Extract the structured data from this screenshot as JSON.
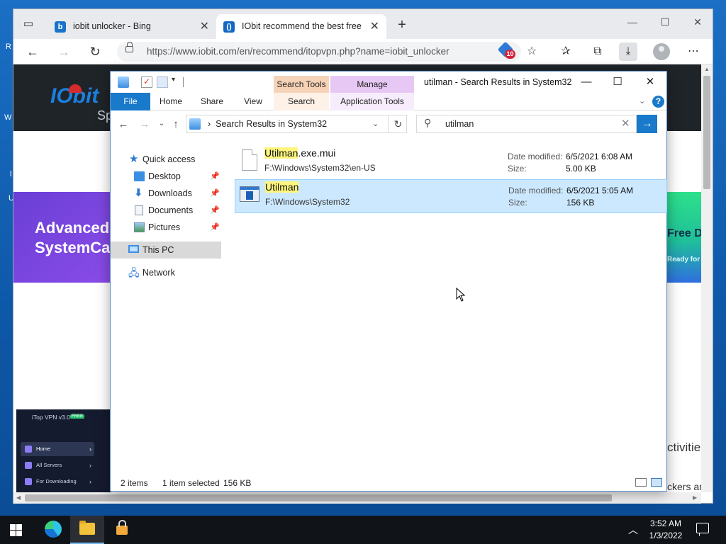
{
  "browser": {
    "tabs": [
      {
        "title": "iobit unlocker - Bing",
        "favicon": "bing-icon",
        "color": "#1a73c9"
      },
      {
        "title": "IObit recommend the best free, IObit",
        "favicon": "iobit-icon",
        "color": "#1467c2"
      }
    ],
    "url": "https://www.iobit.com/en/recommend/itopvpn.php?name=iobit_unlocker",
    "extension_badge": "10"
  },
  "webpage": {
    "banner_left_line1": "Advanced",
    "banner_left_line2": "SystemCa",
    "banner_right_line1": "Free Do",
    "banner_right_line2": "Ready for",
    "promo_title": "iTop VPN v3.0",
    "promo_badge": "FREE",
    "promo_menu": [
      "Home",
      "All Servers",
      "For Downloading"
    ],
    "text_fragment_1": "ctivitie",
    "text_fragment_2": "ckers an"
  },
  "explorer": {
    "title": "utilman - Search Results in System32",
    "context_tabs": {
      "search_tools": "Search Tools",
      "manage": "Manage"
    },
    "ribbon_tabs": [
      "File",
      "Home",
      "Share",
      "View",
      "Search",
      "Application Tools"
    ],
    "address": "Search Results in System32",
    "search_query": "utilman",
    "nav": {
      "quick_access": "Quick access",
      "items": [
        "Desktop",
        "Downloads",
        "Documents",
        "Pictures"
      ],
      "this_pc": "This PC",
      "network": "Network"
    },
    "files": [
      {
        "name_highlight": "Utilman",
        "name_rest": ".exe.mui",
        "path": "F:\\Windows\\System32\\en-US",
        "date_label": "Date modified:",
        "date": "6/5/2021 6:08 AM",
        "size_label": "Size:",
        "size": "5.00 KB"
      },
      {
        "name_highlight": "Utilman",
        "name_rest": "",
        "path": "F:\\Windows\\System32",
        "date_label": "Date modified:",
        "date": "6/5/2021 5:05 AM",
        "size_label": "Size:",
        "size": "156 KB"
      }
    ],
    "status": {
      "count": "2 items",
      "selected": "1 item selected",
      "selected_size": "156 KB"
    }
  },
  "taskbar": {
    "time": "3:52 AM",
    "date": "1/3/2022"
  }
}
